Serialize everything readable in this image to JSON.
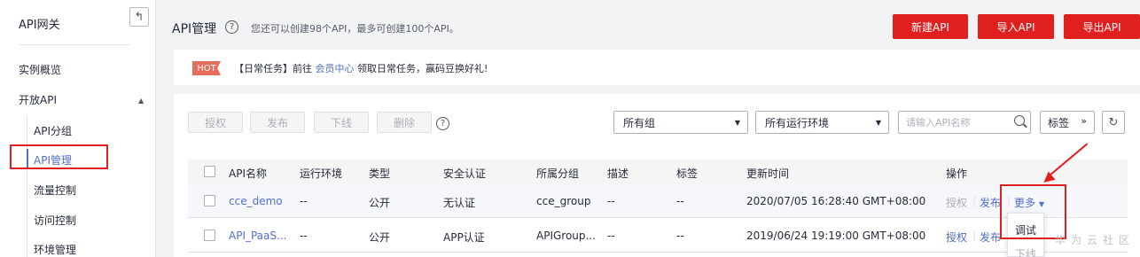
{
  "sidebar": {
    "title": "API网关",
    "items": [
      {
        "label": "实例概览"
      },
      {
        "label": "开放API"
      }
    ],
    "sub_items": [
      {
        "label": "API分组"
      },
      {
        "label": "API管理"
      },
      {
        "label": "流量控制"
      },
      {
        "label": "访问控制"
      },
      {
        "label": "环境管理"
      }
    ]
  },
  "header": {
    "title": "API管理",
    "help": "?",
    "note": "您还可以创建98个API，最多可创建100个API。",
    "buttons": {
      "create": "新建API",
      "import": "导入API",
      "export": "导出API"
    }
  },
  "notice": {
    "badge": "HOT",
    "prefix": "【日常任务】前往",
    "link": "会员中心",
    "suffix": "领取日常任务，赢码豆换好礼!"
  },
  "toolbar": {
    "authorize": "授权",
    "publish": "发布",
    "offline": "下线",
    "delete": "删除",
    "help": "?",
    "group_select": "所有组",
    "env_select": "所有运行环境",
    "search_placeholder": "请输入API名称",
    "tag": "标签"
  },
  "table": {
    "headers": [
      "API名称",
      "运行环境",
      "类型",
      "安全认证",
      "所属分组",
      "描述",
      "标签",
      "更新时间",
      "操作"
    ],
    "rows": [
      {
        "name": "cce_demo",
        "env": "--",
        "type": "公开",
        "auth": "无认证",
        "group": "cce_group",
        "desc": "--",
        "tag": "--",
        "updated": "2020/07/05 16:28:40 GMT+08:00"
      },
      {
        "name": "API_PaaS...",
        "env": "--",
        "type": "公开",
        "auth": "APP认证",
        "group": "APIGroup...",
        "desc": "--",
        "tag": "--",
        "updated": "2019/06/24 19:19:00 GMT+08:00"
      }
    ],
    "ops": {
      "authorize": "授权",
      "publish": "发布",
      "more": "更多",
      "sep": "|"
    }
  },
  "dropdown": {
    "debug": "调试",
    "offline": "下线"
  },
  "watermark": "华为云社区",
  "colors": {
    "brand_red": "#e0201e",
    "link_blue": "#526ecc"
  }
}
